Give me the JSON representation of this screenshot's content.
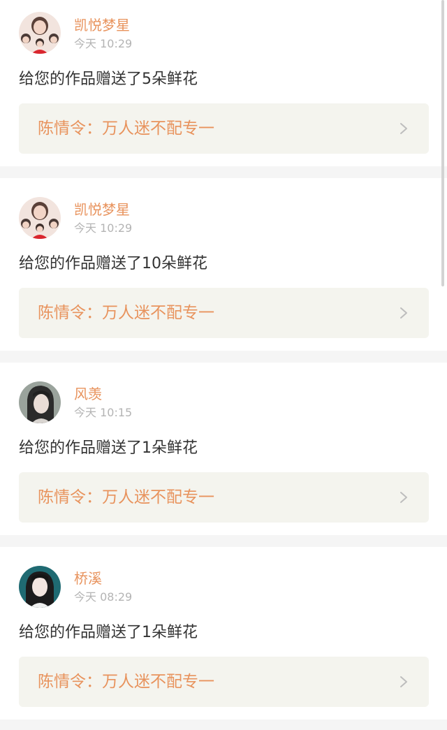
{
  "notifications": [
    {
      "username": "凯悦梦星",
      "time": "今天 10:29",
      "message": "给您的作品赠送了5朵鲜花",
      "work_title": "陈情令：万人迷不配专一",
      "avatar_icon": "user-avatar-group-photo"
    },
    {
      "username": "凯悦梦星",
      "time": "今天 10:29",
      "message": "给您的作品赠送了10朵鲜花",
      "work_title": "陈情令：万人迷不配专一",
      "avatar_icon": "user-avatar-group-photo"
    },
    {
      "username": "风羡",
      "time": "今天 10:15",
      "message": "给您的作品赠送了1朵鲜花",
      "work_title": "陈情令：万人迷不配专一",
      "avatar_icon": "user-avatar-portrait"
    },
    {
      "username": "桥溪",
      "time": "今天 08:29",
      "message": "给您的作品赠送了1朵鲜花",
      "work_title": "陈情令：万人迷不配专一",
      "avatar_icon": "user-avatar-portrait"
    }
  ],
  "colors": {
    "accent": "#e8935d",
    "message_text": "#333333",
    "time_text": "#b4b4b4",
    "card_bg": "#ffffff",
    "link_bg": "#f4f4ee",
    "page_bg": "#f5f5f5"
  }
}
